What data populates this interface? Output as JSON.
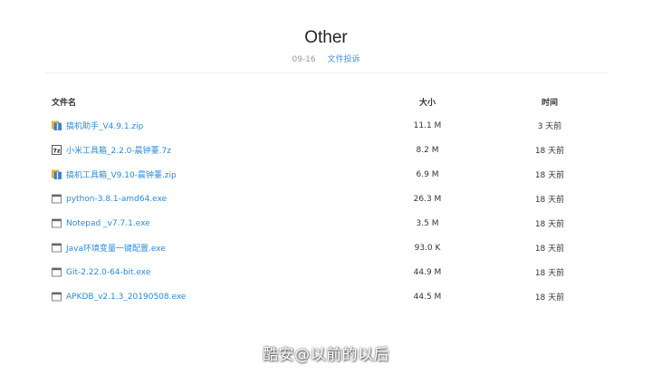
{
  "page": {
    "title": "Other",
    "date": "09-16",
    "report_link": "文件投诉"
  },
  "table": {
    "headers": {
      "name": "文件名",
      "size": "大小",
      "time": "时间"
    },
    "rows": [
      {
        "icon": "zip-archive-icon",
        "name": "搞机助手_V4.9.1.zip",
        "size": "11.1 M",
        "time": "3 天前"
      },
      {
        "icon": "7z-archive-icon",
        "name": "小米工具箱_2.2.0-晨钟薹.7z",
        "size": "8.2 M",
        "time": "18 天前"
      },
      {
        "icon": "zip-archive-icon",
        "name": "搞机工具箱_V9.10-晨钟薹.zip",
        "size": "6.9 M",
        "time": "18 天前"
      },
      {
        "icon": "exe-file-icon",
        "name": "python-3.8.1-amd64.exe",
        "size": "26.3 M",
        "time": "18 天前"
      },
      {
        "icon": "exe-file-icon",
        "name": "Notepad _v7.7.1.exe",
        "size": "3.5 M",
        "time": "18 天前"
      },
      {
        "icon": "exe-file-icon",
        "name": "Java环境变量一键配置.exe",
        "size": "93.0 K",
        "time": "18 天前"
      },
      {
        "icon": "exe-file-icon",
        "name": "Git-2.22.0-64-bit.exe",
        "size": "44.9 M",
        "time": "18 天前"
      },
      {
        "icon": "exe-file-icon",
        "name": "APKDB_v2.1.3_20190508.exe",
        "size": "44.5 M",
        "time": "18 天前"
      }
    ]
  },
  "watermark": "酷安@以前的以后",
  "colors": {
    "link": "#2b8ad8",
    "report_link": "#4a90d9",
    "muted": "#999999",
    "divider": "#eeeeee"
  }
}
